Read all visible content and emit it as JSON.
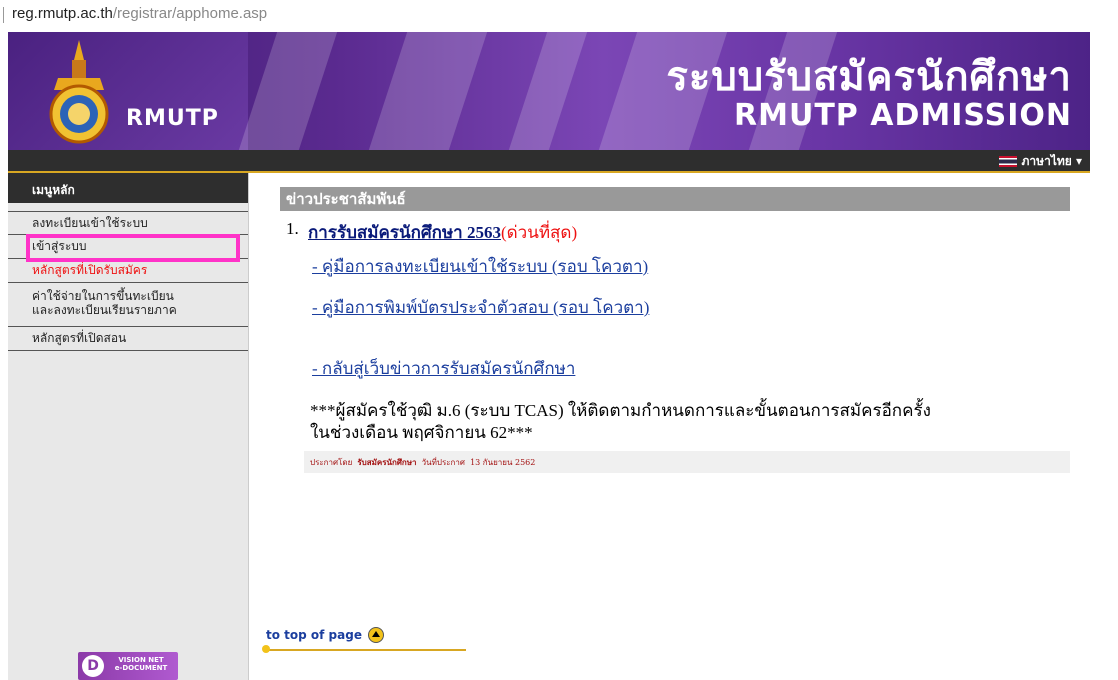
{
  "address_bar": {
    "host": "reg.rmutp.ac.th",
    "path": "/registrar/apphome.asp"
  },
  "banner": {
    "logo_text": "RMUTP",
    "title_th": "ระบบรับสมัครนักศึกษา",
    "title_en": "RMUTP ADMISSION"
  },
  "language": {
    "label": "ภาษาไทย ▾"
  },
  "sidebar": {
    "heading": "เมนูหลัก",
    "items": [
      {
        "label": "ลงทะเบียนเข้าใช้ระบบ"
      },
      {
        "label": "เข้าสู่ระบบ"
      },
      {
        "label": "หลักสูตรที่เปิดรับสมัคร"
      },
      {
        "label_line1": "ค่าใช้จ่ายในการขึ้นทะเบียน",
        "label_line2": "และลงทะเบียนเรียนรายภาค"
      },
      {
        "label": "หลักสูตรที่เปิดสอน"
      }
    ],
    "badge": {
      "letter": "D",
      "line1": "VISION NET",
      "line2": "e-DOCUMENT"
    }
  },
  "main": {
    "section_title": "ข่าวประชาสัมพันธ์",
    "news": [
      {
        "number": "1.",
        "title": "การรับสมัครนักศึกษา 2563",
        "urgent": "(ด่วนที่สุด)",
        "links": [
          "- คู่มือการลงทะเบียนเข้าใช้ระบบ (รอบ โควตา)",
          "- คู่มือการพิมพ์บัตรประจำตัวสอบ (รอบ โควตา)",
          "- กลับสู่เว็บข่าวการรับสมัครนักศึกษา"
        ],
        "notice_line1": "***ผู้สมัครใช้วุฒิ ม.6 (ระบบ TCAS) ให้ติดตามกำหนดการและขั้นตอนการสมัครอีกครั้ง",
        "notice_line2": "ในช่วงเดือน พฤศจิกายน 62***",
        "footer": {
          "posted_by_label": "ประกาศโดย",
          "posted_by": "รับสมัครนักศึกษา",
          "date_label": "วันที่ประกาศ",
          "date": "13 กันยายน 2562"
        }
      }
    ],
    "to_top": "to top of page"
  },
  "colors": {
    "banner": "#5a2a8f",
    "accent_gold": "#d8a722",
    "highlight": "#ff33c8",
    "urgent": "#e11111",
    "link": "#1b3e9e"
  }
}
